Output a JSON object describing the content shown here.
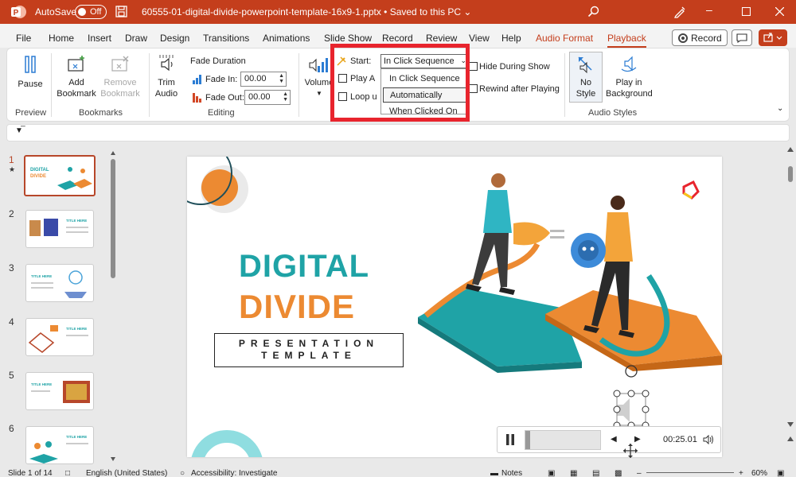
{
  "titlebar": {
    "autosave_label": "AutoSave",
    "autosave_state": "Off",
    "doc_title": "60555-01-digital-divide-powerpoint-template-16x9-1.pptx  •  Saved to this PC ⌄",
    "accent_color": "#c43e1c"
  },
  "menu": {
    "tabs": [
      "File",
      "Home",
      "Insert",
      "Draw",
      "Design",
      "Transitions",
      "Animations",
      "Slide Show",
      "Record",
      "Review",
      "View",
      "Help",
      "Audio Format",
      "Playback"
    ],
    "record_button": "Record"
  },
  "ribbon": {
    "pause": "Pause",
    "add_bookmark": [
      "Add",
      "Bookmark"
    ],
    "remove_bookmark": [
      "Remove",
      "Bookmark"
    ],
    "trim_audio": [
      "Trim",
      "Audio"
    ],
    "fade_duration": "Fade Duration",
    "fade_in_label": "Fade In:",
    "fade_in_value": "00.00",
    "fade_out_label": "Fade Out:",
    "fade_out_value": "00.00",
    "volume": "Volume",
    "start_label": "Start:",
    "start_value": "In Click Sequence",
    "start_options": [
      "In Click Sequence",
      "Automatically",
      "When Clicked On"
    ],
    "play_across": "Play A",
    "loop_until": "Loop u",
    "hide_during_show": "Hide During Show",
    "rewind_after_playing": "Rewind after Playing",
    "no_style": [
      "No",
      "Style"
    ],
    "play_in_background": [
      "Play in",
      "Background"
    ],
    "groups": {
      "preview": "Preview",
      "bookmarks": "Bookmarks",
      "editing": "Editing",
      "audio_styles": "Audio Styles"
    }
  },
  "thumbnails": {
    "numbers": [
      "1",
      "2",
      "3",
      "4",
      "5",
      "6"
    ],
    "star": "★",
    "text": [
      "DIGITAL DIVIDE",
      "TITLE HERE",
      "TITLE HERE",
      "TITLE HERE",
      "TITLE HERE",
      "TITLE HERE"
    ]
  },
  "slide": {
    "line1": "DIGITAL",
    "line2": "DIVIDE",
    "subtitle1": "PRESENTATION",
    "subtitle2": "TEMPLATE"
  },
  "player": {
    "time": "00:25.01"
  },
  "status": {
    "slide_info": "Slide 1 of 14",
    "language": "English (United States)",
    "accessibility": "Accessibility: Investigate",
    "notes": "Notes",
    "zoom": "60%"
  }
}
